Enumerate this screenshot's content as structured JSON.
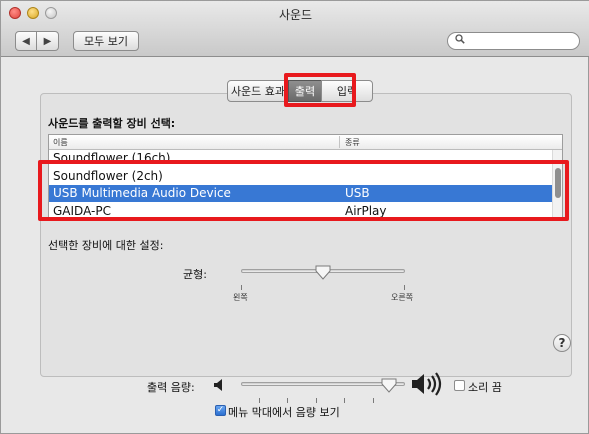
{
  "window": {
    "title": "사운드"
  },
  "toolbar": {
    "back_glyph": "◀",
    "forward_glyph": "▶",
    "show_all_label": "모두 보기",
    "search_placeholder": "",
    "search_icon": "magnifier-icon"
  },
  "tabs": [
    {
      "label": "사운드 효과"
    },
    {
      "label": "출력",
      "selected": true
    },
    {
      "label": "입력"
    }
  ],
  "output": {
    "select_heading": "사운드를 출력할 장비 선택:",
    "columns": {
      "name": "이름",
      "type": "종류"
    },
    "devices": [
      {
        "name": "Soundflower (16ch)",
        "type": ""
      },
      {
        "name": "Soundflower (2ch)",
        "type": ""
      },
      {
        "name": "USB Multimedia Audio Device",
        "type": "USB",
        "selected": true
      },
      {
        "name": "GAIDA-PC",
        "type": "AirPlay"
      }
    ],
    "settings_heading": "선택한 장비에 대한 설정:",
    "balance": {
      "label": "균형:",
      "left": "왼쪽",
      "right": "오른쪽",
      "level": 0.5
    }
  },
  "help": "?",
  "volume": {
    "label": "출력 음량:",
    "level": 0.9,
    "mute_label": "소리 끔",
    "mute_checked": false,
    "menubar_label": "메뉴 막대에서 음량 보기",
    "menubar_checked": true,
    "check_glyph": "✓"
  },
  "colors": {
    "selection": "#3878d4",
    "highlight_box": "#e8191d"
  }
}
